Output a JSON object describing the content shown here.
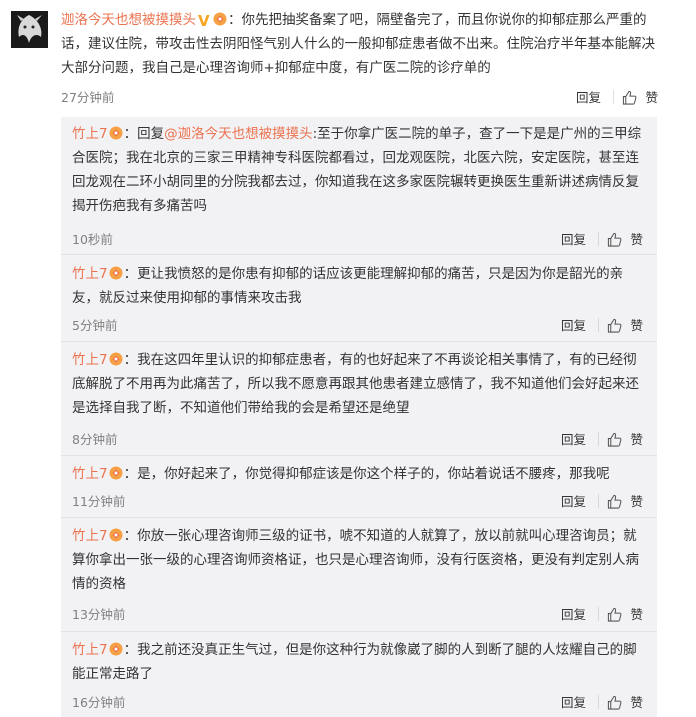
{
  "main_comment": {
    "username": "迦洛今天也想被摸摸头",
    "text": "：你先把抽奖备案了吧，隔壁备完了，而且你说你的抑郁症那么严重的话，建议住院，带攻击性去阴阳怪气别人什么的一般抑郁症患者做不出来。住院治疗半年基本能解决大部分问题，我自己是心理咨询师+抑郁症中度，有广医二院的诊疗单的",
    "time": "27分钟前",
    "reply_label": "回复",
    "like_label": "赞"
  },
  "replies": [
    {
      "username": "竹上7",
      "prefix": "：回复",
      "mention": "@迦洛今天也想被摸摸头",
      "text": ":至于你拿广医二院的单子，查了一下是是广州的三甲综合医院；我在北京的三家三甲精神专科医院都看过，回龙观医院，北医六院，安定医院，甚至连回龙观在二环小胡同里的分院我都去过，你知道我在这多家医院辗转更换医生重新讲述病情反复揭开伤疤我有多痛苦吗",
      "time": "10秒前",
      "reply_label": "回复",
      "like_label": "赞"
    },
    {
      "username": "竹上7",
      "prefix": "",
      "mention": "",
      "text": "：更让我愤怒的是你患有抑郁的话应该更能理解抑郁的痛苦，只是因为你是韶光的亲友，就反过来使用抑郁的事情来攻击我",
      "time": "5分钟前",
      "reply_label": "回复",
      "like_label": "赞"
    },
    {
      "username": "竹上7",
      "prefix": "",
      "mention": "",
      "text": "：我在这四年里认识的抑郁症患者，有的也好起来了不再谈论相关事情了，有的已经彻底解脱了不用再为此痛苦了，所以我不愿意再跟其他患者建立感情了，我不知道他们会好起来还是选择自我了断，不知道他们带给我的会是希望还是绝望",
      "time": "8分钟前",
      "reply_label": "回复",
      "like_label": "赞"
    },
    {
      "username": "竹上7",
      "prefix": "",
      "mention": "",
      "text": "：是，你好起来了，你觉得抑郁症该是你这个样子的，你站着说话不腰疼，那我呢",
      "time": "11分钟前",
      "reply_label": "回复",
      "like_label": "赞"
    },
    {
      "username": "竹上7",
      "prefix": "",
      "mention": "",
      "text": "：你放一张心理咨询师三级的证书，唬不知道的人就算了，放以前就叫心理咨询员；就算你拿出一张一级的心理咨询师资格证，也只是心理咨询师，没有行医资格，更没有判定别人病情的资格",
      "time": "13分钟前",
      "reply_label": "回复",
      "like_label": "赞"
    },
    {
      "username": "竹上7",
      "prefix": "",
      "mention": "",
      "text": "：我之前还没真正生气过，但是你这种行为就像崴了脚的人到断了腿的人炫耀自己的脚能正常走路了",
      "time": "16分钟前",
      "reply_label": "回复",
      "like_label": "赞"
    }
  ],
  "colors": {
    "username": "#eb7350",
    "reply_bg": "#f2f2f5",
    "meta": "#808080"
  },
  "icons": {
    "verified": "v-badge-icon",
    "fan_badge": "fan-badge-icon",
    "like": "thumbs-up-icon"
  }
}
